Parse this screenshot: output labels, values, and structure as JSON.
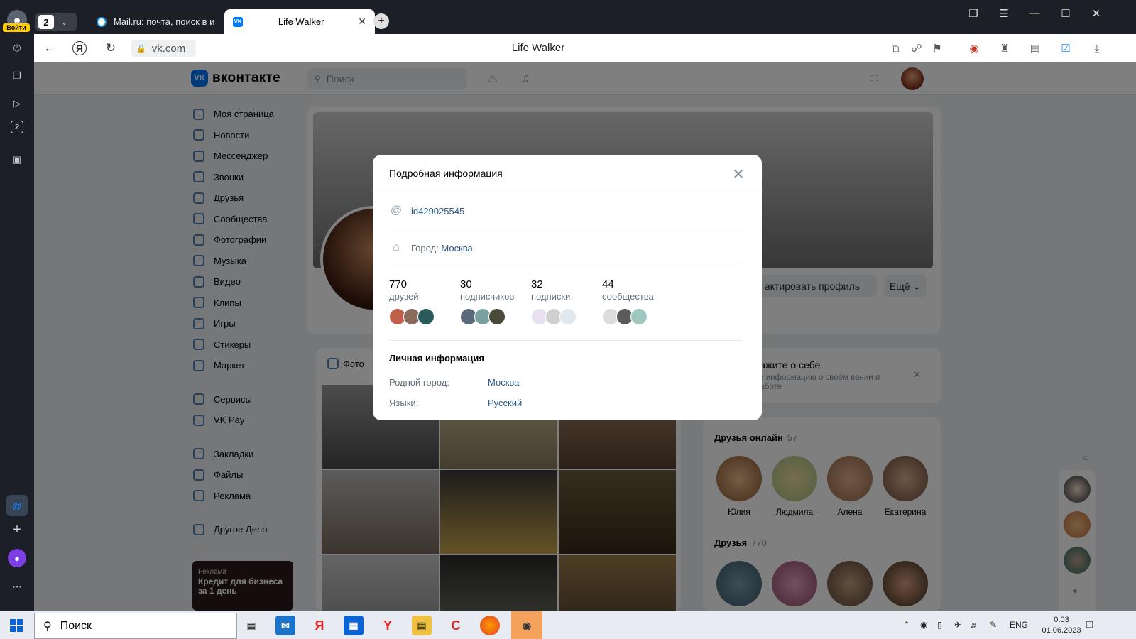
{
  "browser": {
    "login_label": "Войти",
    "tab_count": "2",
    "tabs": [
      {
        "title": "Mail.ru: почта, поиск в интернете"
      },
      {
        "title": "Life Walker"
      }
    ],
    "url": "vk.com",
    "page_title": "Life Walker",
    "sidebar_badge": "2"
  },
  "vk": {
    "logo_text": "вконтакте",
    "search_placeholder": "Поиск",
    "menu": [
      "Моя страница",
      "Новости",
      "Мессенджер",
      "Звонки",
      "Друзья",
      "Сообщества",
      "Фотографии",
      "Музыка",
      "Видео",
      "Клипы",
      "Игры",
      "Стикеры",
      "Маркет"
    ],
    "menu2": [
      "Сервисы",
      "VK Pay"
    ],
    "menu3": [
      "Закладки",
      "Файлы",
      "Реклама"
    ],
    "menu4": [
      "Другое Дело"
    ],
    "ad": {
      "label": "Реклама",
      "title": "Кредит для бизнеса за 1 день"
    },
    "profile": {
      "edit_button": "актировать профиль",
      "more_button": "Ещё"
    },
    "photos_tab": "Фото",
    "about": {
      "title": "кажите о себе",
      "text": "те информацию о своём вании и работе"
    },
    "friends_online": {
      "title": "Друзья онлайн",
      "count": "57",
      "names": [
        "Юлия",
        "Людмила",
        "Алена",
        "Екатерина"
      ]
    },
    "friends": {
      "title": "Друзья",
      "count": "770"
    }
  },
  "modal": {
    "title": "Подробная информация",
    "id": "id429025545",
    "city_label": "Город:",
    "city_value": "Москва",
    "stats": [
      {
        "number": "770",
        "label": "друзей"
      },
      {
        "number": "30",
        "label": "подписчиков"
      },
      {
        "number": "32",
        "label": "подписки"
      },
      {
        "number": "44",
        "label": "сообщества"
      }
    ],
    "personal_title": "Личная информация",
    "hometown_label": "Родной город:",
    "hometown_value": "Москва",
    "languages_label": "Языки:",
    "languages_value": "Русский"
  },
  "taskbar": {
    "search_placeholder": "Поиск",
    "lang": "ENG",
    "time": "0:03",
    "date": "01.06.2023"
  },
  "colors": {
    "vk_blue": "#0077ff",
    "link": "#2a5885",
    "overlay": "rgba(0,0,0,0.5)"
  }
}
